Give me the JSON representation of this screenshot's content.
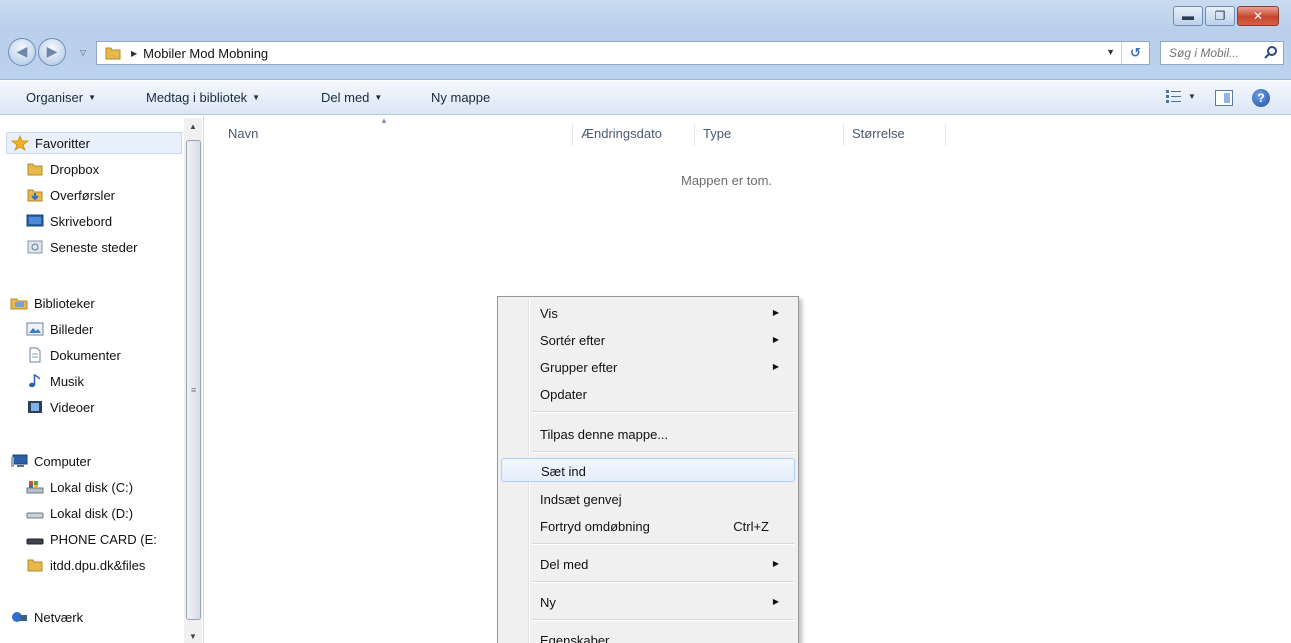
{
  "window": {
    "controls": [
      "minimize",
      "maximize",
      "close"
    ]
  },
  "address_bar": {
    "breadcrumb": "Mobiler Mod Mobning"
  },
  "search": {
    "placeholder": "Søg i Mobil..."
  },
  "toolbar": {
    "organize": "Organiser",
    "include_library": "Medtag i bibliotek",
    "share_with": "Del med",
    "new_folder": "Ny mappe"
  },
  "navigation": {
    "favorites": {
      "label": "Favoritter",
      "items": [
        "Dropbox",
        "Overførsler",
        "Skrivebord",
        "Seneste steder"
      ]
    },
    "libraries": {
      "label": "Biblioteker",
      "items": [
        "Billeder",
        "Dokumenter",
        "Musik",
        "Videoer"
      ]
    },
    "computer": {
      "label": "Computer",
      "items": [
        "Lokal disk (C:)",
        "Lokal disk (D:)",
        "PHONE CARD (E:",
        "itdd.dpu.dk&files"
      ]
    },
    "network": {
      "label": "Netværk"
    }
  },
  "columns": [
    "Navn",
    "Ændringsdato",
    "Type",
    "Størrelse"
  ],
  "empty_message": "Mappen er tom.",
  "context_menu": {
    "items": [
      {
        "label": "Vis",
        "submenu": true
      },
      {
        "label": "Sortér efter",
        "submenu": true
      },
      {
        "label": "Grupper efter",
        "submenu": true
      },
      {
        "label": "Opdater"
      },
      {
        "label": "Tilpas denne mappe..."
      },
      {
        "label": "Sæt ind",
        "highlighted": true
      },
      {
        "label": "Indsæt genvej"
      },
      {
        "label": "Fortryd omdøbning",
        "shortcut": "Ctrl+Z"
      },
      {
        "label": "Del med",
        "submenu": true
      },
      {
        "label": "Ny",
        "submenu": true
      },
      {
        "label": "Egenskaber"
      }
    ]
  },
  "colors": {
    "titlebar": "#bcd2ec",
    "menu_highlight_border": "#aecff7",
    "selection": "#e8f0fb"
  }
}
